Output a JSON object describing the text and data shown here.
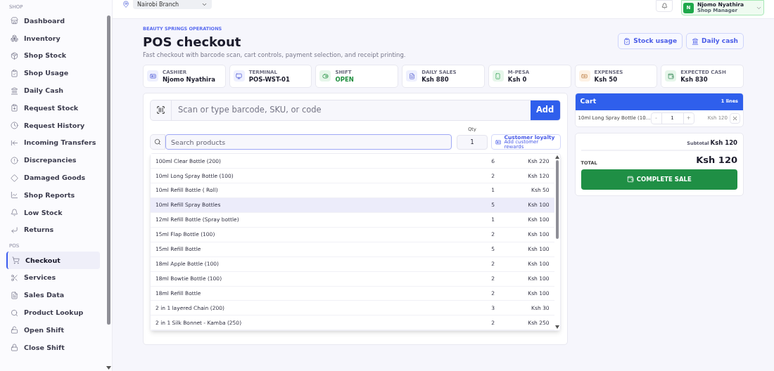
{
  "sidebar": {
    "sections": [
      {
        "title": "SHOP",
        "items": [
          {
            "label": "Dashboard",
            "kind": "store",
            "selected": false
          },
          {
            "label": "Inventory",
            "kind": "boxes",
            "selected": false
          },
          {
            "label": "Shop Stock",
            "kind": "package",
            "selected": false
          },
          {
            "label": "Shop Usage",
            "kind": "bag",
            "selected": false
          },
          {
            "label": "Daily Cash",
            "kind": "bank",
            "selected": false
          },
          {
            "label": "Request Stock",
            "kind": "clipboard",
            "selected": false
          },
          {
            "label": "Request History",
            "kind": "clock",
            "selected": false
          },
          {
            "label": "Incoming Transfers",
            "kind": "transfer",
            "selected": false
          },
          {
            "label": "Discrepancies",
            "kind": "alert",
            "selected": false
          },
          {
            "label": "Damaged Goods",
            "kind": "diamond",
            "selected": false
          },
          {
            "label": "Shop Reports",
            "kind": "chart",
            "selected": false
          },
          {
            "label": "Low Stock",
            "kind": "bell",
            "selected": false
          },
          {
            "label": "Returns",
            "kind": "return",
            "selected": false
          }
        ]
      },
      {
        "title": "POS",
        "items": [
          {
            "label": "Checkout",
            "kind": "cart",
            "selected": true
          },
          {
            "label": "Services",
            "kind": "scissors",
            "selected": false
          },
          {
            "label": "Sales Data",
            "kind": "file",
            "selected": false
          },
          {
            "label": "Product Lookup",
            "kind": "search",
            "selected": false
          },
          {
            "label": "Open Shift",
            "kind": "unlock",
            "selected": false
          },
          {
            "label": "Close Shift",
            "kind": "lock",
            "selected": false
          }
        ]
      }
    ]
  },
  "header": {
    "branch": "Nairobi Branch",
    "user": {
      "initial": "N",
      "name": "Njomo Nyathira",
      "role": "Shop Manager"
    }
  },
  "page": {
    "eyebrow": "BEAUTY SPRINGS OPERATIONS",
    "title": "POS checkout",
    "subtitle": "Fast checkout with barcode scan, cart controls, payment selection, and receipt printing.",
    "actions": [
      {
        "label": "Stock usage",
        "kind": "bag"
      },
      {
        "label": "Daily cash",
        "kind": "bank"
      }
    ]
  },
  "stats": [
    {
      "kind": "cashier",
      "label": "CASHIER",
      "value": "Njomo Nyathira"
    },
    {
      "kind": "terminal",
      "label": "TERMINAL",
      "value": "POS-WST-01"
    },
    {
      "kind": "shift",
      "label": "SHIFT",
      "value": "OPEN"
    },
    {
      "kind": "sales",
      "label": "DAILY SALES",
      "value": "Ksh 880"
    },
    {
      "kind": "mpesa",
      "label": "M-PESA",
      "value": "Ksh 0"
    },
    {
      "kind": "expenses",
      "label": "EXPENSES",
      "value": "Ksh 50"
    },
    {
      "kind": "cash",
      "label": "EXPECTED CASH",
      "value": "Ksh 830"
    }
  ],
  "scan": {
    "placeholder": "Scan or type barcode, SKU, or code",
    "button": "Add"
  },
  "search": {
    "placeholder": "Search products",
    "qty_label": "Qty",
    "qty": "1",
    "loyalty": {
      "title": "Customer loyalty",
      "subtitle": "Add customer rewards"
    }
  },
  "products": [
    {
      "name": "100ml Clear Bottle (200)",
      "stock": "6",
      "price": "Ksh 220",
      "highlighted": false
    },
    {
      "name": "10ml Long Spray Bottle (100)",
      "stock": "2",
      "price": "Ksh 120",
      "highlighted": false
    },
    {
      "name": "10ml Refill Bottle ( Roll)",
      "stock": "1",
      "price": "Ksh 50",
      "highlighted": false
    },
    {
      "name": "10ml Refill Spray Bottles",
      "stock": "5",
      "price": "Ksh 100",
      "highlighted": true
    },
    {
      "name": "12ml Refill Bottle (Spray bottle)",
      "stock": "1",
      "price": "Ksh 100",
      "highlighted": false
    },
    {
      "name": "15ml Flap Bottle (100)",
      "stock": "2",
      "price": "Ksh 100",
      "highlighted": false
    },
    {
      "name": "15ml Refill Bottle",
      "stock": "5",
      "price": "Ksh 100",
      "highlighted": false
    },
    {
      "name": "18ml Apple Bottle (100)",
      "stock": "2",
      "price": "Ksh 100",
      "highlighted": false
    },
    {
      "name": "18ml Bowtie Bottle (100)",
      "stock": "2",
      "price": "Ksh 100",
      "highlighted": false
    },
    {
      "name": "18ml Refill Bottle",
      "stock": "2",
      "price": "Ksh 100",
      "highlighted": false
    },
    {
      "name": "2 in 1 layered Chain (200)",
      "stock": "3",
      "price": "Ksh 30",
      "highlighted": false
    },
    {
      "name": "2 in 1 Silk Bonnet - Kamba (250)",
      "stock": "2",
      "price": "Ksh 250",
      "highlighted": false
    }
  ],
  "cart": {
    "title": "Cart",
    "count": "1 lines",
    "lines": [
      {
        "name": "10ml Long Spray Bottle (10...",
        "minus": "-",
        "qty": "1",
        "plus": "+",
        "price": "Ksh 120"
      }
    ]
  },
  "totals": {
    "subtotal_label": "Subtotal",
    "subtotal": "Ksh 120",
    "total_label": "TOTAL",
    "total": "Ksh 120",
    "button": "COMPLETE SALE"
  }
}
